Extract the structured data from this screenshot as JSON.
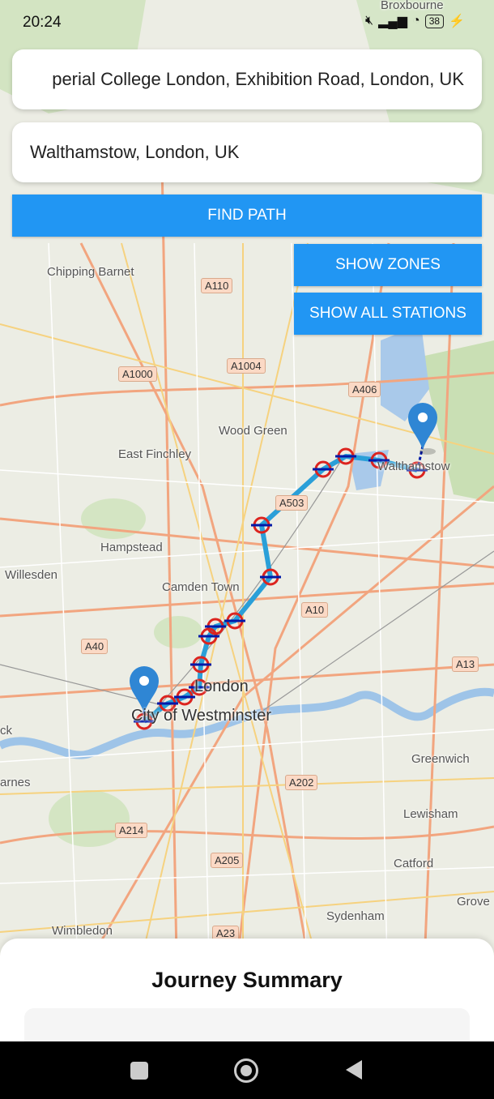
{
  "status_bar": {
    "time": "20:24",
    "battery": "38"
  },
  "search": {
    "origin_value": "Imperial College London, Exhibition Road, London, UK",
    "origin_visible": "perial College London, Exhibition Road, London, UK",
    "destination_value": "Walthamstow, London, UK"
  },
  "buttons": {
    "find_path": "FIND PATH",
    "show_zones": "SHOW ZONES",
    "show_all_stations": "SHOW ALL STATIONS"
  },
  "map": {
    "places": {
      "broxbourne": "Broxbourne",
      "chipping_barnet": "Chipping Barnet",
      "wood_green": "Wood Green",
      "east_finchley": "East Finchley",
      "walthamstow": "Walthamstow",
      "hampstead": "Hampstead",
      "willesden": "Willesden",
      "camden_town": "Camden Town",
      "london": "London",
      "city_of_westminster": "City of Westminster",
      "greenwich": "Greenwich",
      "lewisham": "Lewisham",
      "catford": "Catford",
      "sydenham": "Sydenham",
      "wimbledon": "Wimbledon",
      "grove": "Grove",
      "barnes": "arnes",
      "kew": "ck"
    },
    "roads": {
      "a110": "A110",
      "a1000": "A1000",
      "a1004": "A1004",
      "a406": "A406",
      "a503": "A503",
      "a10": "A10",
      "a40": "A40",
      "a13": "A13",
      "a202": "A202",
      "a214": "A214",
      "a205": "A205",
      "a23": "A23"
    },
    "marker_start": "Imperial College London",
    "marker_end": "Walthamstow",
    "route_color": "#2a9fd8",
    "station_color": "#dc241f"
  },
  "journey_summary": {
    "title": "Journey Summary"
  }
}
